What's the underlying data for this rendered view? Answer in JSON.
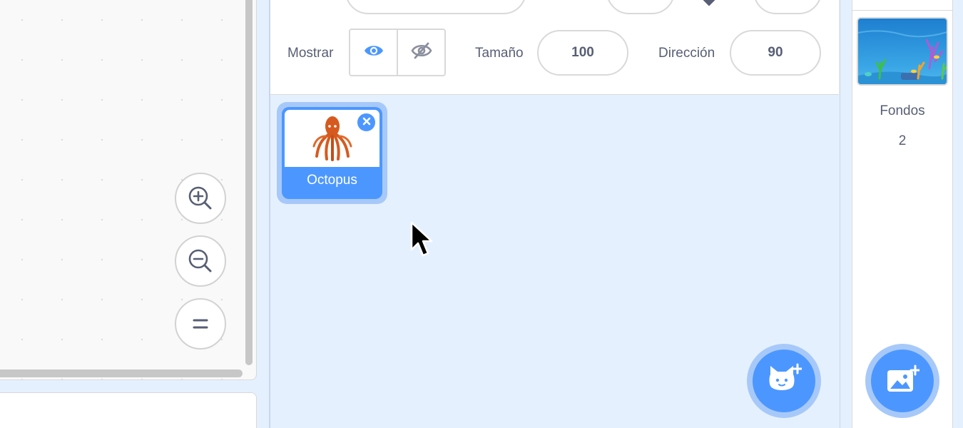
{
  "sprite_info": {
    "show_label": "Mostrar",
    "size_label": "Tamaño",
    "size_value": "100",
    "direction_label": "Dirección",
    "direction_value": "90"
  },
  "sprites": [
    {
      "name": "Octopus",
      "selected": true
    }
  ],
  "stage": {
    "backdrops_label": "Fondos",
    "backdrops_count": "2"
  },
  "icons": {
    "zoom_in": "zoom-in-icon",
    "zoom_out": "zoom-out-icon",
    "zoom_reset": "equals-icon",
    "show": "eye-icon",
    "hide": "eye-slash-icon",
    "delete": "close-icon",
    "add_sprite": "cat-plus-icon",
    "add_backdrop": "image-plus-icon"
  },
  "colors": {
    "accent": "#4c97ff",
    "accent_light": "#a7c9f9",
    "pane_background": "#e5f0ff",
    "text": "#575e75"
  }
}
